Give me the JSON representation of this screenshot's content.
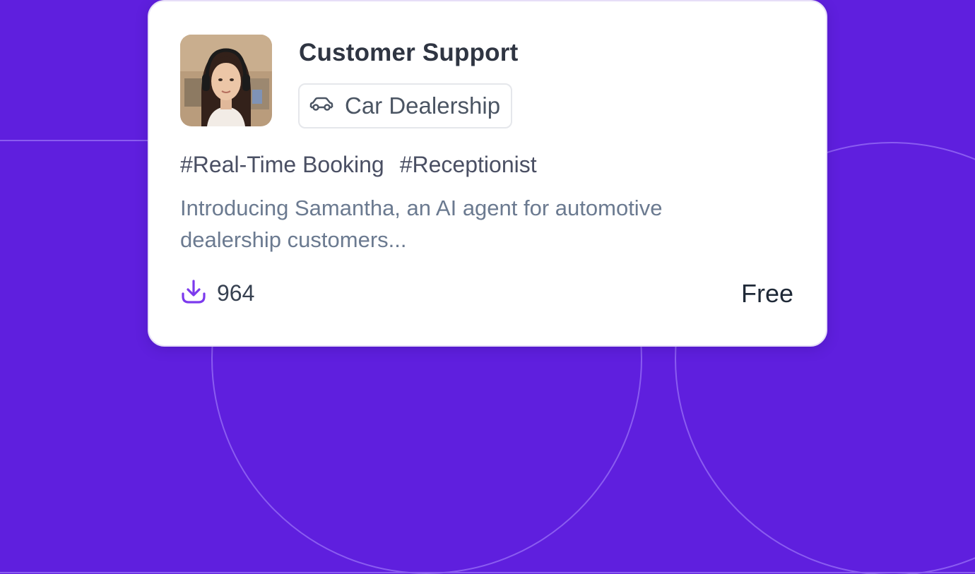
{
  "colors": {
    "background": "#5f1fde",
    "card": "#ffffff",
    "accent": "#7c3aed",
    "title": "#2f3542",
    "description": "#6b7a90"
  },
  "card": {
    "avatar_alt": "Samantha avatar",
    "title": "Customer Support",
    "category": {
      "icon": "car-icon",
      "label": "Car Dealership"
    },
    "tags": [
      "#Real-Time Booking",
      "#Receptionist"
    ],
    "description": "Introducing Samantha, an AI agent for automotive dealership customers...",
    "downloads": {
      "icon": "download-icon",
      "count": "964"
    },
    "price": "Free"
  }
}
